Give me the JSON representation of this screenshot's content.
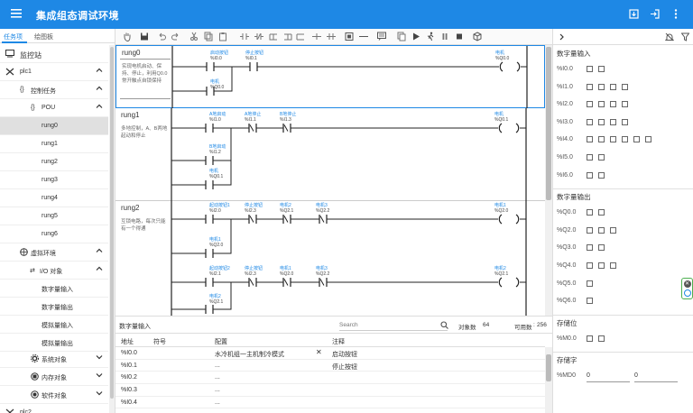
{
  "app": {
    "title": "集成组态调试环境"
  },
  "left": {
    "tabs": [
      "任务项",
      "绘图板"
    ],
    "root": "监控站",
    "plc1": "plc1",
    "control_task": "控制任务",
    "pou": "POU",
    "rungs": [
      "rung0",
      "rung1",
      "rung2",
      "rung3",
      "rung4",
      "rung5",
      "rung6"
    ],
    "virtual_env": "虚拟环境",
    "io_objects": "I/O 对象",
    "io_items": [
      "数字量输入",
      "数字量输出",
      "模拟量输入",
      "模拟量输出"
    ],
    "system_objects": "系统对象",
    "memory_objects": "内存对象",
    "software_objects": "软件对象",
    "plc2": "plc2"
  },
  "toolbar": {
    "icons": [
      "hand-icon",
      "save-icon",
      "undo-icon",
      "redo-icon",
      "cut-icon",
      "copy-icon",
      "paste-icon",
      "insert-contact-icon",
      "insert-contact2-icon",
      "insert-neg-icon",
      "insert-branch-icon",
      "insert-coil-icon",
      "add-rung-icon",
      "delete-icon",
      "comment-icon",
      "download-icon",
      "run-icon",
      "step-icon",
      "pause-icon",
      "stop-icon",
      "box-icon"
    ]
  },
  "ladder": {
    "rungs": [
      {
        "name": "rung0",
        "desc": "实现电机启动、保持、停止，利用Q0.0常开触点自锁保持",
        "elements": [
          {
            "name": "启动按钮",
            "addr": "%I0.0"
          },
          {
            "name": "停止按钮",
            "addr": "%I0.1"
          },
          {
            "name": "电机",
            "addr": "%Q0.0"
          },
          {
            "name": "电机",
            "addr": "%Q0.0"
          }
        ]
      },
      {
        "name": "rung1",
        "desc": "多地控制，A、B两地起动和停止",
        "elements": [
          {
            "name": "A地启动",
            "addr": "%I1.0"
          },
          {
            "name": "A地停止",
            "addr": "%I1.1"
          },
          {
            "name": "B地停止",
            "addr": "%I1.3"
          },
          {
            "name": "电机",
            "addr": "%Q0.1"
          },
          {
            "name": "B地启动",
            "addr": "%I1.2"
          },
          {
            "name": "电机",
            "addr": "%Q0.1"
          }
        ]
      },
      {
        "name": "rung2",
        "desc": "互锁电路，每次只能有一个得通",
        "elements": [
          {
            "name": "起动按钮1",
            "addr": "%I2.0"
          },
          {
            "name": "停止按钮",
            "addr": "%I2.3"
          },
          {
            "name": "电机2",
            "addr": "%Q2.1"
          },
          {
            "name": "电机3",
            "addr": "%Q2.2"
          },
          {
            "name": "电机1",
            "addr": "%Q2.0"
          },
          {
            "name": "电机1",
            "addr": "%Q2.0"
          },
          {
            "name": "起动按钮2",
            "addr": "%I2.1"
          },
          {
            "name": "停止按钮",
            "addr": "%I2.3"
          },
          {
            "name": "电机1",
            "addr": "%Q2.0"
          },
          {
            "name": "电机3",
            "addr": "%Q2.2"
          },
          {
            "name": "电机2",
            "addr": "%Q2.1"
          },
          {
            "name": "电机2",
            "addr": "%Q2.1"
          }
        ]
      }
    ]
  },
  "io_panel": {
    "title": "数字量输入",
    "search_placeholder": "Search",
    "count_label": "对象数",
    "count": "64",
    "avail_label": "可用数",
    "avail": "256",
    "columns": [
      "地址",
      "符号",
      "配置",
      "注释"
    ],
    "rows": [
      {
        "addr": "%I0.0",
        "symbol": "",
        "config": "水冷机组一主机制冷模式",
        "comment": "启动按钮"
      },
      {
        "addr": "%I0.1",
        "symbol": "",
        "config": "...",
        "comment": "停止按钮"
      },
      {
        "addr": "%I0.2",
        "symbol": "",
        "config": "...",
        "comment": ""
      },
      {
        "addr": "%I0.3",
        "symbol": "",
        "config": "...",
        "comment": ""
      },
      {
        "addr": "%I0.4",
        "symbol": "",
        "config": "...",
        "comment": ""
      }
    ]
  },
  "right": {
    "digital_in_title": "数字量输入",
    "digital_in": [
      {
        "reg": "%I0.0",
        "bits": 2
      },
      {
        "reg": "%I1.0",
        "bits": 4
      },
      {
        "reg": "%I2.0",
        "bits": 4
      },
      {
        "reg": "%I3.0",
        "bits": 4
      },
      {
        "reg": "%I4.0",
        "bits": 6
      },
      {
        "reg": "%I5.0",
        "bits": 2
      },
      {
        "reg": "%I6.0",
        "bits": 2
      }
    ],
    "digital_out_title": "数字量输出",
    "digital_out": [
      {
        "reg": "%Q0.0",
        "bits": 2
      },
      {
        "reg": "%Q2.0",
        "bits": 3
      },
      {
        "reg": "%Q3.0",
        "bits": 2
      },
      {
        "reg": "%Q4.0",
        "bits": 3
      },
      {
        "reg": "%Q5.0",
        "bits": 1
      },
      {
        "reg": "%Q6.0",
        "bits": 1
      }
    ],
    "bit_mem_title": "存储位",
    "bit_mem": [
      {
        "reg": "%M0.0",
        "bits": 2
      }
    ],
    "word_mem_title": "存储字",
    "word_mem": {
      "reg": "%MD0",
      "v1": "0",
      "v2": "0"
    }
  },
  "colors": {
    "accent": "#1e88e5",
    "topbar": "#1e88e5",
    "selected": "#e0e0e0"
  }
}
